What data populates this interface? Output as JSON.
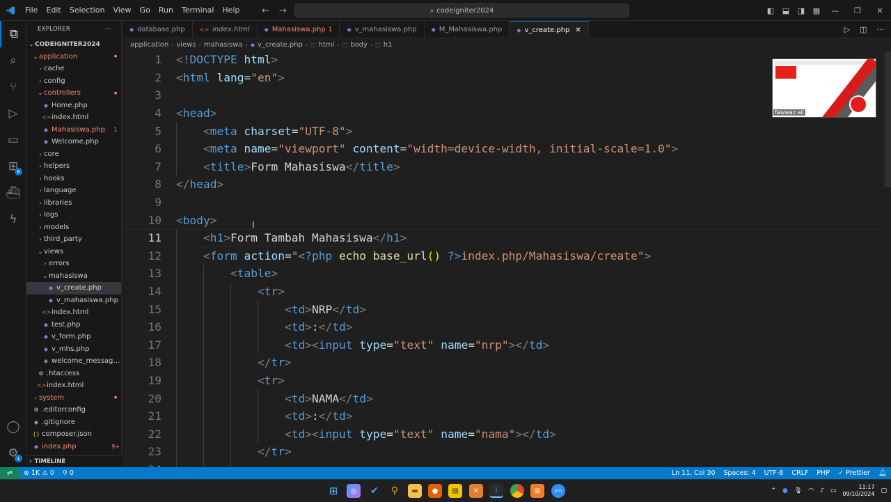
{
  "titlebar": {
    "menu": [
      "File",
      "Edit",
      "Selection",
      "View",
      "Go",
      "Run",
      "Terminal",
      "Help"
    ],
    "search_text": "codeigniter2024"
  },
  "explorer": {
    "title": "EXPLORER",
    "root": "CODEIGNITER2024",
    "items": [
      {
        "label": "application",
        "kind": "folder",
        "open": true,
        "depth": 0,
        "status": "red-dot"
      },
      {
        "label": "cache",
        "kind": "folder",
        "open": false,
        "depth": 1
      },
      {
        "label": "config",
        "kind": "folder",
        "open": false,
        "depth": 1
      },
      {
        "label": "controllers",
        "kind": "folder",
        "open": true,
        "depth": 1,
        "status": "red-dot"
      },
      {
        "label": "Home.php",
        "kind": "php",
        "depth": 2
      },
      {
        "label": "index.html",
        "kind": "html",
        "depth": 2
      },
      {
        "label": "Mahasiswa.php",
        "kind": "php",
        "depth": 2,
        "status": "1"
      },
      {
        "label": "Welcome.php",
        "kind": "php",
        "depth": 2
      },
      {
        "label": "core",
        "kind": "folder",
        "open": false,
        "depth": 1
      },
      {
        "label": "helpers",
        "kind": "folder",
        "open": false,
        "depth": 1
      },
      {
        "label": "hooks",
        "kind": "folder",
        "open": false,
        "depth": 1
      },
      {
        "label": "language",
        "kind": "folder",
        "open": false,
        "depth": 1
      },
      {
        "label": "libraries",
        "kind": "folder",
        "open": false,
        "depth": 1
      },
      {
        "label": "logs",
        "kind": "folder",
        "open": false,
        "depth": 1
      },
      {
        "label": "models",
        "kind": "folder",
        "open": false,
        "depth": 1
      },
      {
        "label": "third_party",
        "kind": "folder",
        "open": false,
        "depth": 1
      },
      {
        "label": "views",
        "kind": "folder",
        "open": true,
        "depth": 1
      },
      {
        "label": "errors",
        "kind": "folder",
        "open": false,
        "depth": 2
      },
      {
        "label": "mahasiswa",
        "kind": "folder",
        "open": true,
        "depth": 2
      },
      {
        "label": "v_create.php",
        "kind": "php",
        "depth": 3,
        "selected": true
      },
      {
        "label": "v_mahasiswa.php",
        "kind": "php",
        "depth": 3
      },
      {
        "label": "index.html",
        "kind": "html",
        "depth": 2
      },
      {
        "label": "test.php",
        "kind": "php",
        "depth": 2
      },
      {
        "label": "v_form.php",
        "kind": "php",
        "depth": 2
      },
      {
        "label": "v_mhs.php",
        "kind": "php",
        "depth": 2
      },
      {
        "label": "welcome_message...",
        "kind": "php",
        "depth": 2
      },
      {
        "label": ".htaccess",
        "kind": "gear",
        "depth": 1
      },
      {
        "label": "index.html",
        "kind": "html",
        "depth": 1
      },
      {
        "label": "system",
        "kind": "folder",
        "open": false,
        "depth": 0,
        "status": "red-dot"
      },
      {
        "label": ".editorconfig",
        "kind": "gear",
        "depth": 0
      },
      {
        "label": ".gitignore",
        "kind": "git",
        "depth": 0
      },
      {
        "label": "composer.json",
        "kind": "json",
        "depth": 0
      },
      {
        "label": "index.php",
        "kind": "php",
        "depth": 0,
        "status": "9+"
      }
    ],
    "timeline": "TIMELINE"
  },
  "tabs": [
    {
      "label": "database.php",
      "icon": "php-icon"
    },
    {
      "label": "index.html",
      "icon": "html-icon",
      "italic": true
    },
    {
      "label": "Mahasiswa.php",
      "icon": "php-icon",
      "modified": "1"
    },
    {
      "label": "v_mahasiswa.php",
      "icon": "php-icon"
    },
    {
      "label": "M_Mahasiswa.php",
      "icon": "php-icon"
    },
    {
      "label": "v_create.php",
      "icon": "php-icon",
      "active": true
    }
  ],
  "breadcrumb": [
    "application",
    "views",
    "mahasiswa",
    "v_create.php",
    "html",
    "body",
    "h1"
  ],
  "code": [
    {
      "n": "1",
      "i": 0,
      "t": [
        [
          "p",
          "<!"
        ],
        [
          "tg",
          "DOCTYPE"
        ],
        [
          "tx",
          " "
        ],
        [
          "at",
          "html"
        ],
        [
          "p",
          ">"
        ]
      ]
    },
    {
      "n": "2",
      "i": 0,
      "t": [
        [
          "p",
          "<"
        ],
        [
          "tg",
          "html"
        ],
        [
          "tx",
          " "
        ],
        [
          "at",
          "lang"
        ],
        [
          "tx",
          "="
        ],
        [
          "st",
          "\"en\""
        ],
        [
          "p",
          ">"
        ]
      ]
    },
    {
      "n": "3",
      "i": 0,
      "t": []
    },
    {
      "n": "4",
      "i": 0,
      "t": [
        [
          "p",
          "<"
        ],
        [
          "tg",
          "head"
        ],
        [
          "p",
          ">"
        ]
      ]
    },
    {
      "n": "5",
      "i": 1,
      "t": [
        [
          "p",
          "<"
        ],
        [
          "tg",
          "meta"
        ],
        [
          "tx",
          " "
        ],
        [
          "at",
          "charset"
        ],
        [
          "tx",
          "="
        ],
        [
          "st",
          "\"UTF-8\""
        ],
        [
          "p",
          ">"
        ]
      ]
    },
    {
      "n": "6",
      "i": 1,
      "t": [
        [
          "p",
          "<"
        ],
        [
          "tg",
          "meta"
        ],
        [
          "tx",
          " "
        ],
        [
          "at",
          "name"
        ],
        [
          "tx",
          "="
        ],
        [
          "st",
          "\"viewport\""
        ],
        [
          "tx",
          " "
        ],
        [
          "at",
          "content"
        ],
        [
          "tx",
          "="
        ],
        [
          "st",
          "\"width=device-width, initial-scale=1.0\""
        ],
        [
          "p",
          ">"
        ]
      ]
    },
    {
      "n": "7",
      "i": 1,
      "t": [
        [
          "p",
          "<"
        ],
        [
          "tg",
          "title"
        ],
        [
          "p",
          ">"
        ],
        [
          "tx",
          "Form Mahasiswa"
        ],
        [
          "p",
          "</"
        ],
        [
          "tg",
          "title"
        ],
        [
          "p",
          ">"
        ]
      ]
    },
    {
      "n": "8",
      "i": 0,
      "t": [
        [
          "p",
          "</"
        ],
        [
          "tg",
          "head"
        ],
        [
          "p",
          ">"
        ]
      ]
    },
    {
      "n": "9",
      "i": 0,
      "t": []
    },
    {
      "n": "10",
      "i": 0,
      "t": [
        [
          "p",
          "<"
        ],
        [
          "tg",
          "body"
        ],
        [
          "p",
          ">"
        ]
      ]
    },
    {
      "n": "11",
      "i": 1,
      "cur": true,
      "t": [
        [
          "p",
          "<"
        ],
        [
          "tg",
          "h1"
        ],
        [
          "p",
          ">"
        ],
        [
          "tx",
          "Form Tambah Mahasiswa"
        ],
        [
          "p",
          "</"
        ],
        [
          "tg",
          "h1"
        ],
        [
          "p",
          ">"
        ]
      ]
    },
    {
      "n": "12",
      "i": 1,
      "t": [
        [
          "p",
          "<"
        ],
        [
          "tg",
          "form"
        ],
        [
          "tx",
          " "
        ],
        [
          "at",
          "action"
        ],
        [
          "tx",
          "="
        ],
        [
          "st",
          "\""
        ],
        [
          "ph",
          "<?php"
        ],
        [
          "tx",
          " "
        ],
        [
          "kw",
          "echo"
        ],
        [
          "tx",
          " "
        ],
        [
          "fn",
          "base_url"
        ],
        [
          "pa",
          "()"
        ],
        [
          "tx",
          " "
        ],
        [
          "ph",
          "?>"
        ],
        [
          "st",
          "index.php/Mahasiswa/create\""
        ],
        [
          "p",
          ">"
        ]
      ]
    },
    {
      "n": "13",
      "i": 2,
      "t": [
        [
          "p",
          "<"
        ],
        [
          "tg",
          "table"
        ],
        [
          "p",
          ">"
        ]
      ]
    },
    {
      "n": "14",
      "i": 3,
      "t": [
        [
          "p",
          "<"
        ],
        [
          "tg",
          "tr"
        ],
        [
          "p",
          ">"
        ]
      ]
    },
    {
      "n": "15",
      "i": 4,
      "t": [
        [
          "p",
          "<"
        ],
        [
          "tg",
          "td"
        ],
        [
          "p",
          ">"
        ],
        [
          "tx",
          "NRP"
        ],
        [
          "p",
          "</"
        ],
        [
          "tg",
          "td"
        ],
        [
          "p",
          ">"
        ]
      ]
    },
    {
      "n": "16",
      "i": 4,
      "t": [
        [
          "p",
          "<"
        ],
        [
          "tg",
          "td"
        ],
        [
          "p",
          ">"
        ],
        [
          "tx",
          ":"
        ],
        [
          "p",
          "</"
        ],
        [
          "tg",
          "td"
        ],
        [
          "p",
          ">"
        ]
      ]
    },
    {
      "n": "17",
      "i": 4,
      "t": [
        [
          "p",
          "<"
        ],
        [
          "tg",
          "td"
        ],
        [
          "p",
          "><"
        ],
        [
          "tg",
          "input"
        ],
        [
          "tx",
          " "
        ],
        [
          "at",
          "type"
        ],
        [
          "tx",
          "="
        ],
        [
          "st",
          "\"text\""
        ],
        [
          "tx",
          " "
        ],
        [
          "at",
          "name"
        ],
        [
          "tx",
          "="
        ],
        [
          "st",
          "\"nrp\""
        ],
        [
          "p",
          "></"
        ],
        [
          "tg",
          "td"
        ],
        [
          "p",
          ">"
        ]
      ]
    },
    {
      "n": "18",
      "i": 3,
      "t": [
        [
          "p",
          "</"
        ],
        [
          "tg",
          "tr"
        ],
        [
          "p",
          ">"
        ]
      ]
    },
    {
      "n": "19",
      "i": 3,
      "t": [
        [
          "p",
          "<"
        ],
        [
          "tg",
          "tr"
        ],
        [
          "p",
          ">"
        ]
      ]
    },
    {
      "n": "20",
      "i": 4,
      "t": [
        [
          "p",
          "<"
        ],
        [
          "tg",
          "td"
        ],
        [
          "p",
          ">"
        ],
        [
          "tx",
          "NAMA"
        ],
        [
          "p",
          "</"
        ],
        [
          "tg",
          "td"
        ],
        [
          "p",
          ">"
        ]
      ]
    },
    {
      "n": "21",
      "i": 4,
      "t": [
        [
          "p",
          "<"
        ],
        [
          "tg",
          "td"
        ],
        [
          "p",
          ">"
        ],
        [
          "tx",
          ":"
        ],
        [
          "p",
          "</"
        ],
        [
          "tg",
          "td"
        ],
        [
          "p",
          ">"
        ]
      ]
    },
    {
      "n": "22",
      "i": 4,
      "t": [
        [
          "p",
          "<"
        ],
        [
          "tg",
          "td"
        ],
        [
          "p",
          "><"
        ],
        [
          "tg",
          "input"
        ],
        [
          "tx",
          " "
        ],
        [
          "at",
          "type"
        ],
        [
          "tx",
          "="
        ],
        [
          "st",
          "\"text\""
        ],
        [
          "tx",
          " "
        ],
        [
          "at",
          "name"
        ],
        [
          "tx",
          "="
        ],
        [
          "st",
          "\"nama\""
        ],
        [
          "p",
          "></"
        ],
        [
          "tg",
          "td"
        ],
        [
          "p",
          ">"
        ]
      ]
    },
    {
      "n": "23",
      "i": 3,
      "t": [
        [
          "p",
          "</"
        ],
        [
          "tg",
          "tr"
        ],
        [
          "p",
          ">"
        ]
      ]
    },
    {
      "n": "24",
      "i": 3,
      "t": []
    }
  ],
  "webcam": {
    "name": "fawwaz ali"
  },
  "statusbar": {
    "errors": "1K",
    "warnings": "0",
    "ports": "0",
    "position": "Ln 11, Col 30",
    "spaces": "Spaces: 4",
    "encoding": "UTF-8",
    "eol": "CRLF",
    "language": "PHP",
    "formatter": "Prettier"
  },
  "taskbar": {
    "time": "11:17",
    "date": "09/10/2024"
  },
  "colors": {
    "accent": "#007acc",
    "editor_bg": "#1f1f1f",
    "tag": "#569cd6",
    "attr": "#9cdcfe",
    "string": "#ce9178"
  }
}
